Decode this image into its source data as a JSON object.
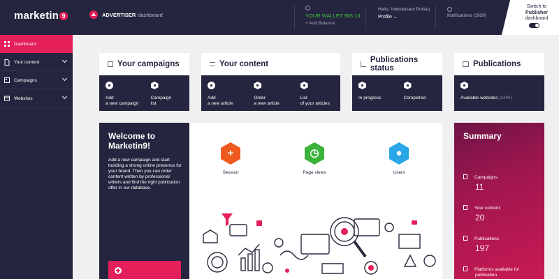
{
  "topbar": {
    "logo_text": "marketin",
    "logo_badge": "9",
    "advertiser_label": "ADVERTISER",
    "advertiser_sub": "dashboard",
    "wallet_amount": "YOUR WALLET 905.13",
    "add_balance": "+ Add Balance",
    "greeting": "Hello, Internetsam Polska",
    "profile_label": "Profile",
    "notifications_label": "Notifications (1939)",
    "switch_line1": "Switch to",
    "switch_line2": "Publisher",
    "switch_line3": "dashboard"
  },
  "sidebar": {
    "items": [
      {
        "label": "Dashboard",
        "icon": "grid-icon",
        "active": true
      },
      {
        "label": "Your content",
        "icon": "document-icon"
      },
      {
        "label": "Campaigns",
        "icon": "campaign-icon"
      },
      {
        "label": "Websites",
        "icon": "globe-icon"
      }
    ]
  },
  "cards": {
    "campaigns": {
      "title": "Your campaigns",
      "actions": [
        {
          "line1": "Add",
          "line2": "a new campaign"
        },
        {
          "line1": "Campaign",
          "line2": "list"
        }
      ]
    },
    "content": {
      "title": "Your content",
      "actions": [
        {
          "line1": "Add",
          "line2": "a new article"
        },
        {
          "line1": "Order",
          "line2": "a new article"
        },
        {
          "line1": "List",
          "line2": "of your articles"
        }
      ]
    },
    "status": {
      "title": "Publications status",
      "actions": [
        {
          "line1": "In progress"
        },
        {
          "line1": "Completed"
        }
      ]
    },
    "publications": {
      "title": "Publications",
      "actions": [
        {
          "line1": "Available websites",
          "count": "(3494)"
        }
      ]
    }
  },
  "welcome": {
    "title": "Welcome to Marketin9!",
    "text": "Add a new campaign and start building a strong online presence for your brand. Then you can order content written by professional writers and find the right publication offer in our database."
  },
  "stats": [
    {
      "label": "Session",
      "color": "#f05a1e",
      "symbol": "+"
    },
    {
      "label": "Page views",
      "color": "#3bb33a",
      "symbol": "◷"
    },
    {
      "label": "Users",
      "color": "#29a6e6",
      "symbol": "●"
    }
  ],
  "summary": {
    "title": "Summary",
    "items": [
      {
        "label": "Campaigns",
        "value": "11"
      },
      {
        "label": "Your content",
        "value": "20"
      },
      {
        "label": "Publications",
        "value": "197"
      },
      {
        "label": "Platforms available for",
        "label2": "publication"
      }
    ]
  },
  "colors": {
    "navy": "#25253f",
    "accent": "#e41f5a",
    "wallet_green": "#41c63c"
  }
}
